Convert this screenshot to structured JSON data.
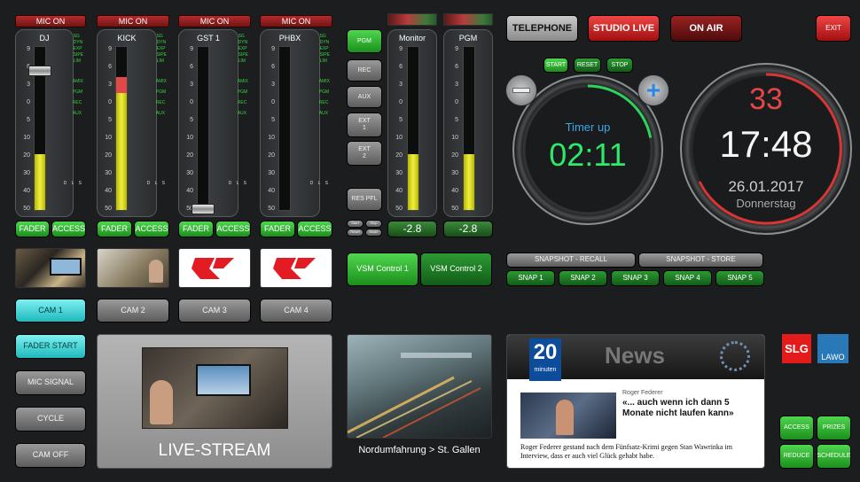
{
  "mic_on": "MIC ON",
  "strips": [
    {
      "name": "DJ",
      "level": 0.34
    },
    {
      "name": "KICK",
      "level": 0.75
    },
    {
      "name": "GST 1",
      "level": 0
    },
    {
      "name": "PHBX",
      "level": 0
    }
  ],
  "strip_labels": {
    "top": [
      "SG",
      "DYN",
      "EXP",
      "SIPE",
      "LIM"
    ],
    "bottom": [
      "AMIX",
      "PGM",
      "REC",
      "AUX"
    ],
    "dls": "D L S"
  },
  "scale": [
    "9",
    "6",
    "3",
    "0",
    "5",
    "10",
    "20",
    "30",
    "40",
    "50"
  ],
  "fader_label": "FADER",
  "access_label": "ACCESS",
  "source_buttons": [
    "PGM",
    "REC",
    "AUX",
    "EXT\n1",
    "EXT\n2",
    "RES PFL"
  ],
  "mini_buttons": [
    "Start",
    "Stop",
    "Reset",
    "Mode"
  ],
  "monitor": {
    "name": "Monitor",
    "value": "-2.8",
    "level": 0.34
  },
  "pgm": {
    "name": "PGM",
    "value": "-2.8",
    "level": 0.34
  },
  "top_buttons": {
    "telephone": "TELEPHONE",
    "studio_live": "STUDIO LIVE",
    "on_air": "ON AIR",
    "exit": "EXIT"
  },
  "timer_controls": [
    "START",
    "RESET",
    "STOP"
  ],
  "timer": {
    "label": "Timer up",
    "value": "02:11",
    "progress": 0.22
  },
  "clock": {
    "seconds": "33",
    "time": "17:48",
    "date": "26.01.2017",
    "day": "Donnerstag"
  },
  "cams": [
    "CAM 1",
    "CAM 2",
    "CAM 3",
    "CAM 4"
  ],
  "vsm": [
    "VSM Control 1",
    "VSM Control 2"
  ],
  "snapshot": {
    "recall": "SNAPSHOT - RECALL",
    "store": "SNAPSHOT - STORE",
    "snaps": [
      "SNAP 1",
      "SNAP 2",
      "SNAP 3",
      "SNAP 4",
      "SNAP 5"
    ]
  },
  "left_buttons": [
    "FADER START",
    "MIC SIGNAL",
    "CYCLE",
    "CAM OFF"
  ],
  "livestream": "LIVE-STREAM",
  "traffic_caption": "Nordumfahrung > St. Gallen",
  "news": {
    "logo_top": "20",
    "logo_bottom": "minuten",
    "title": "News",
    "author": "Roger Federer",
    "headline": "«... auch wenn ich dann 5 Monate nicht laufen kann»",
    "body": "Roger Federer gestand nach dem Fünfsatz-Krimi gegen Stan Wawrinka im Interview, dass er auch viel Glück gehabt habe."
  },
  "brands": {
    "slg": "SLG",
    "lawo": "LAWO"
  },
  "bottom_right": [
    "ACCESS",
    "PRIZES",
    "REDUCE",
    "SCHEDULE"
  ],
  "colors": {
    "green": "#3cd43c",
    "red": "#e53b3b",
    "cyan": "#2fd0d4",
    "timer": "#2de86a"
  }
}
